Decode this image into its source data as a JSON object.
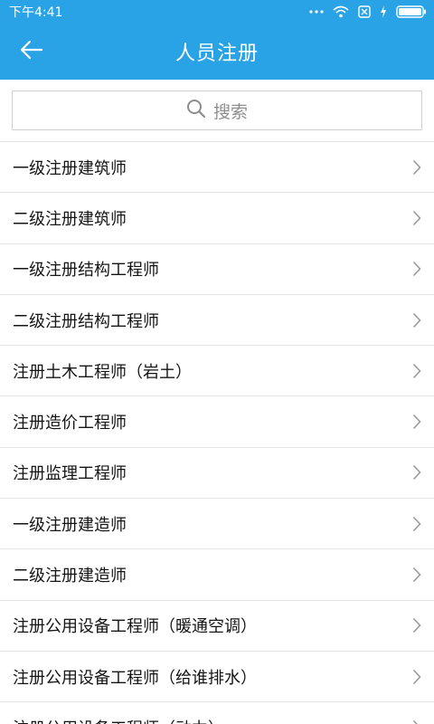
{
  "status": {
    "time": "下午4:41",
    "icons": [
      "dots-icon",
      "wifi-icon",
      "sim-off-icon",
      "charging-icon",
      "battery-icon"
    ]
  },
  "appbar": {
    "title": "人员注册",
    "back_icon": "arrow-left-icon"
  },
  "search": {
    "placeholder": "搜索",
    "icon": "search-icon"
  },
  "list": {
    "items": [
      {
        "label": "一级注册建筑师"
      },
      {
        "label": "二级注册建筑师"
      },
      {
        "label": "一级注册结构工程师"
      },
      {
        "label": "二级注册结构工程师"
      },
      {
        "label": "注册土木工程师（岩土）"
      },
      {
        "label": "注册造价工程师"
      },
      {
        "label": "注册监理工程师"
      },
      {
        "label": "一级注册建造师"
      },
      {
        "label": "二级注册建造师"
      },
      {
        "label": "注册公用设备工程师（暖通空调）"
      },
      {
        "label": "注册公用设备工程师（给谁排水）"
      },
      {
        "label": "注册公用设备工程师（动力）"
      }
    ]
  },
  "colors": {
    "primary": "#2aa3e6",
    "divider": "#e3e3e3",
    "chevron": "#9a9a9a"
  }
}
